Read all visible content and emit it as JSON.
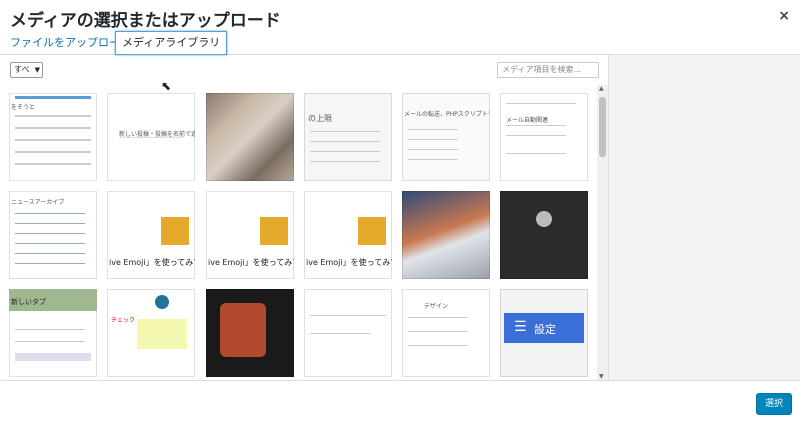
{
  "modal": {
    "title": "メディアの選択またはアップロード",
    "close": "×"
  },
  "tabs": {
    "upload": "ファイルをアップロード",
    "library": "メディアライブラリ"
  },
  "toolbar": {
    "filter_selected": "すべ",
    "search_placeholder": "メディア項目を検索..."
  },
  "tiles": [
    {
      "label": "をそうと"
    },
    {
      "label": "新しい投稿・投稿を名前で追加"
    },
    {
      "label": ""
    },
    {
      "label": "の上限"
    },
    {
      "label": "メールの転送、PHPスクリプトでの"
    },
    {
      "label": "メール自動関連"
    },
    {
      "label": "ニュースアーカイブ"
    },
    {
      "label": "ive Emoji」を使ってみてくだ"
    },
    {
      "label": "ive Emoji」を使ってみてくだ"
    },
    {
      "label": "ive Emoji」を使ってみてくだ"
    },
    {
      "label": ""
    },
    {
      "label": ""
    },
    {
      "label": "新しいタブ"
    },
    {
      "label": "チェック"
    },
    {
      "label": ""
    },
    {
      "label": ""
    },
    {
      "label": "デザイン"
    },
    {
      "label": "設定"
    }
  ],
  "footer": {
    "select_label": "選択"
  }
}
